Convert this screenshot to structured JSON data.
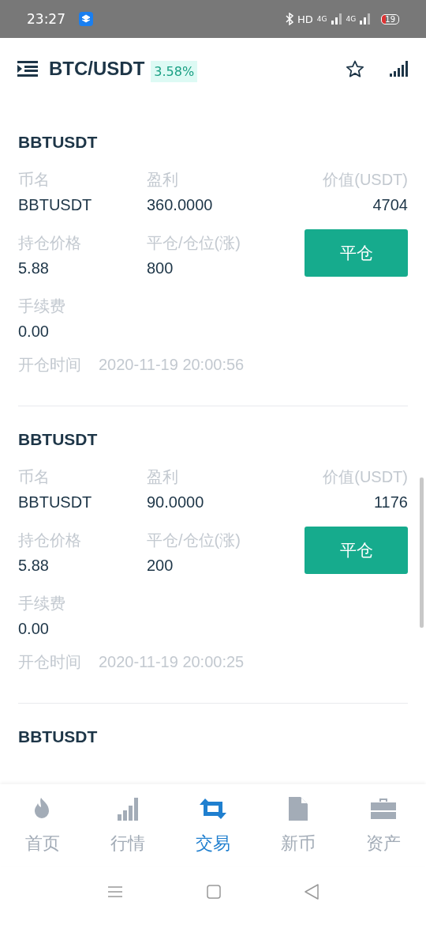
{
  "status_bar": {
    "time": "23:27",
    "hd": "HD",
    "network_1": "4G",
    "network_2": "4G",
    "battery": "19"
  },
  "header": {
    "pair": "BTC/USDT",
    "change": "3.58%"
  },
  "positions": [
    {
      "title": "BBTUSDT",
      "name_label": "币名",
      "name": "BBTUSDT",
      "profit_label": "盈利",
      "profit": "360.0000",
      "value_label": "价值(USDT)",
      "value": "4704",
      "price_label": "持仓价格",
      "price": "5.88",
      "qty_label": "平仓/仓位(涨)",
      "qty": "800",
      "button": "平仓",
      "fee_label": "手续费",
      "fee": "0.00",
      "time_label": "开仓时间",
      "time": "2020-11-19 20:00:56"
    },
    {
      "title": "BBTUSDT",
      "name_label": "币名",
      "name": "BBTUSDT",
      "profit_label": "盈利",
      "profit": "90.0000",
      "value_label": "价值(USDT)",
      "value": "1176",
      "price_label": "持仓价格",
      "price": "5.88",
      "qty_label": "平仓/仓位(涨)",
      "qty": "200",
      "button": "平仓",
      "fee_label": "手续费",
      "fee": "0.00",
      "time_label": "开仓时间",
      "time": "2020-11-19 20:00:25"
    },
    {
      "title": "BBTUSDT"
    }
  ],
  "tab_bar": [
    {
      "kind": "home",
      "label": "首页",
      "selected": false
    },
    {
      "kind": "market",
      "label": "行情",
      "selected": false
    },
    {
      "kind": "trade",
      "label": "交易",
      "selected": true
    },
    {
      "kind": "coin",
      "label": "新币",
      "selected": false
    },
    {
      "kind": "assets",
      "label": "资产",
      "selected": false
    }
  ]
}
